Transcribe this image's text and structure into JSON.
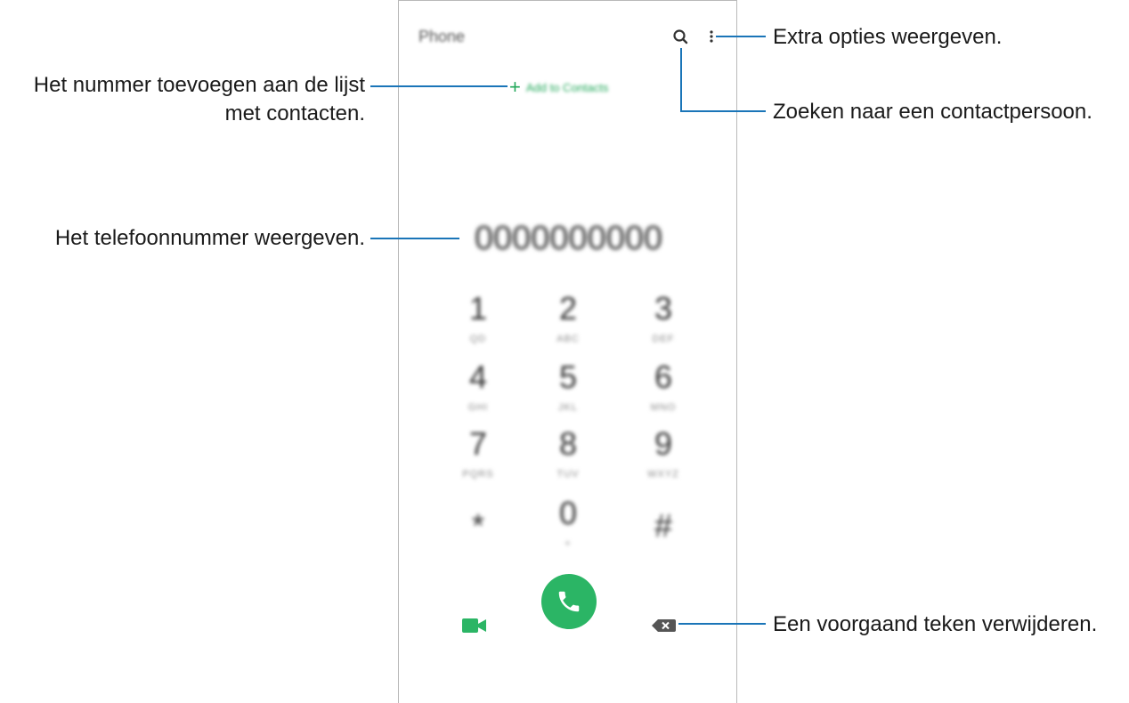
{
  "phone": {
    "app_title": "Phone",
    "add_to_contacts": "Add to Contacts",
    "add_plus": "+",
    "number": "0000000000",
    "keys": [
      {
        "digit": "1",
        "letters": "QD"
      },
      {
        "digit": "2",
        "letters": "ABC"
      },
      {
        "digit": "3",
        "letters": "DEF"
      },
      {
        "digit": "4",
        "letters": "GHI"
      },
      {
        "digit": "5",
        "letters": "JKL"
      },
      {
        "digit": "6",
        "letters": "MNO"
      },
      {
        "digit": "7",
        "letters": "PQRS"
      },
      {
        "digit": "8",
        "letters": "TUV"
      },
      {
        "digit": "9",
        "letters": "WXYZ"
      },
      {
        "digit": "*",
        "letters": ""
      },
      {
        "digit": "0",
        "letters": "+"
      },
      {
        "digit": "#",
        "letters": ""
      }
    ]
  },
  "callouts": {
    "more_options": "Extra opties weergeven.",
    "search": "Zoeken naar een contactpersoon.",
    "add_contact_line1": "Het nummer toevoegen aan de lijst",
    "add_contact_line2": "met contacten.",
    "number_display": "Het telefoonnummer weergeven.",
    "backspace": "Een voorgaand teken verwijderen."
  },
  "colors": {
    "accent_green": "#2bb565",
    "callout_blue": "#1a75b8"
  },
  "icons": {
    "search": "search-icon",
    "more": "more-vertical-icon",
    "video": "video-call-icon",
    "call": "phone-icon",
    "backspace": "backspace-icon"
  }
}
